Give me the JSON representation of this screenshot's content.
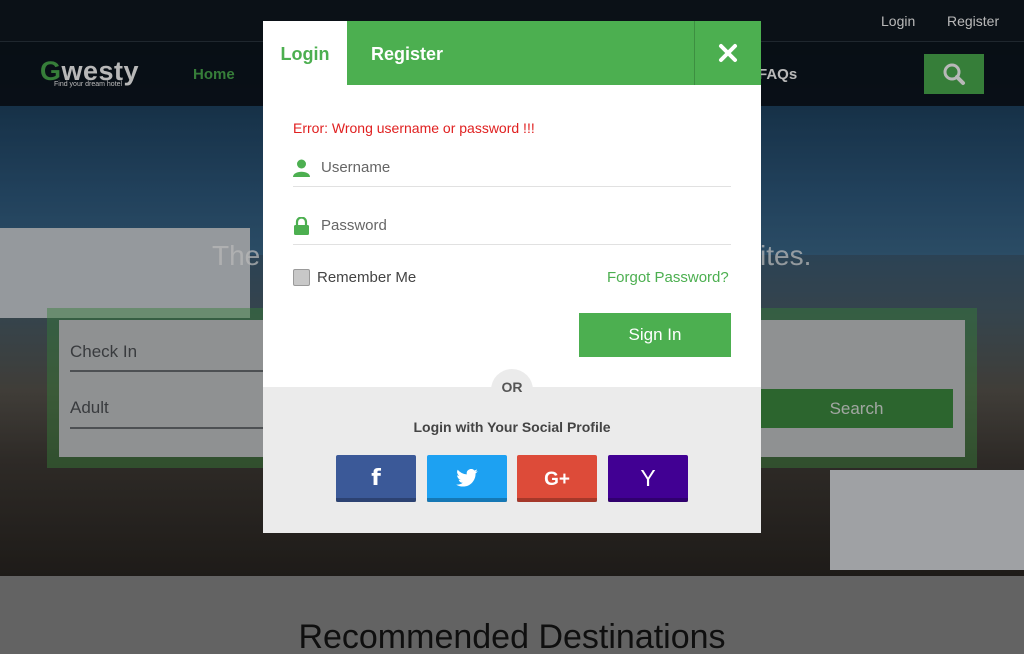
{
  "topbar": {
    "login": "Login",
    "register": "Register"
  },
  "brand": {
    "name": "Gwesty",
    "first_letter": "G",
    "rest": "westy",
    "tagline": "Find your dream hotel"
  },
  "nav": {
    "home": "Home",
    "faqs": "FAQs"
  },
  "hero": {
    "title_left": "The",
    "title_right": "ites."
  },
  "search_form": {
    "checkin_placeholder": "Check In",
    "adult_placeholder": "Adult",
    "search_label": "Search"
  },
  "section": {
    "title": "Recommended Destinations"
  },
  "modal": {
    "tabs": {
      "login": "Login",
      "register": "Register"
    },
    "close_icon": "close-x",
    "error": "Error: Wrong username or password !!!",
    "username_placeholder": "Username",
    "password_placeholder": "Password",
    "remember_label": "Remember Me",
    "forgot_label": "Forgot Password?",
    "signin_label": "Sign In",
    "or_label": "OR",
    "social_title": "Login with Your Social Profile",
    "social": [
      {
        "name": "facebook",
        "glyph": "f",
        "color": "#3b5998"
      },
      {
        "name": "twitter",
        "glyph": "🐦",
        "color": "#1da1f2"
      },
      {
        "name": "google-plus",
        "glyph": "G+",
        "color": "#dd4b39"
      },
      {
        "name": "yahoo",
        "glyph": "Y",
        "color": "#410093"
      }
    ]
  },
  "colors": {
    "accent": "#4caf50",
    "error": "#e02020"
  }
}
